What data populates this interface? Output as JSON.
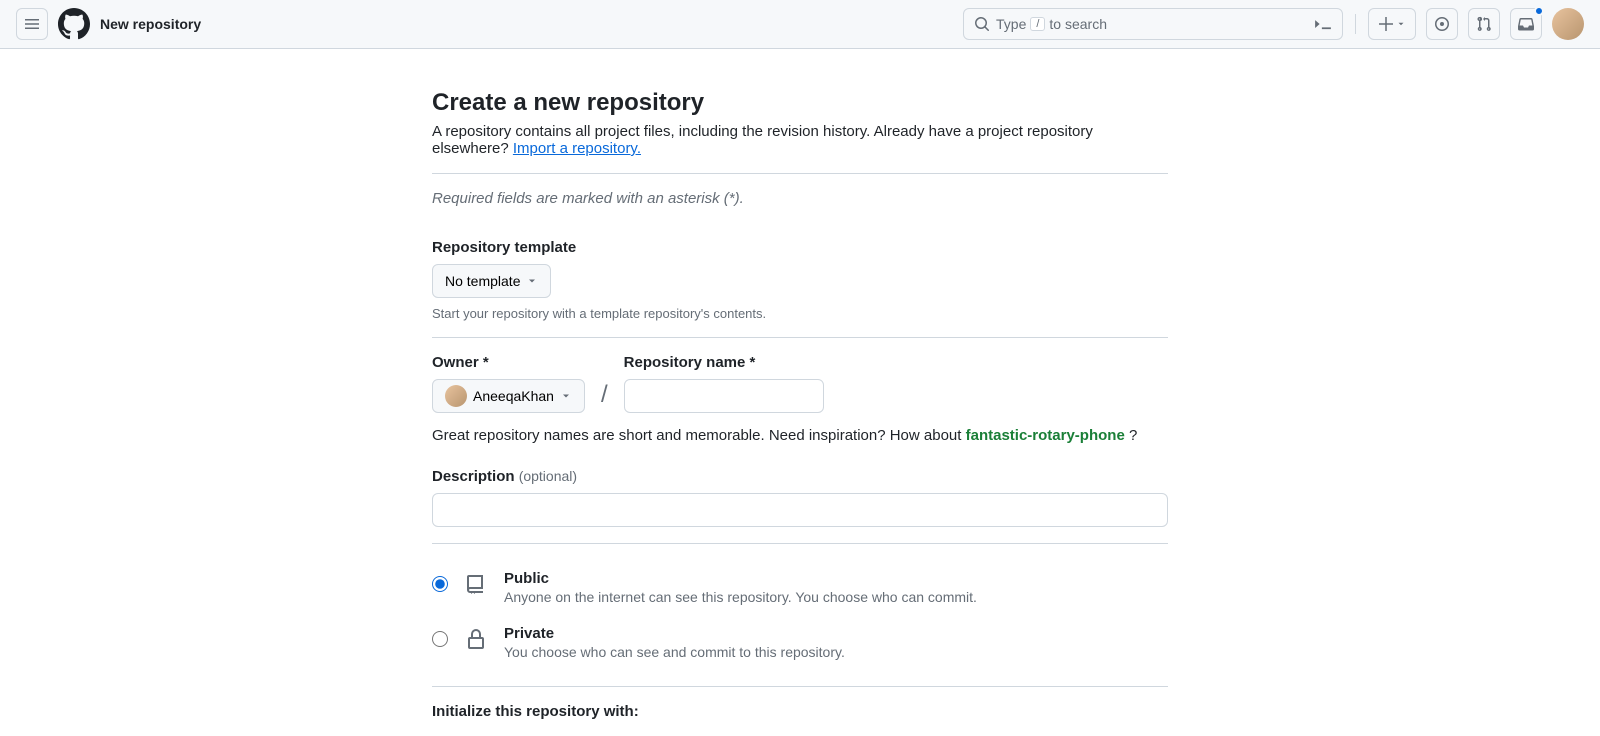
{
  "header": {
    "title": "New repository",
    "search_prefix": "Type",
    "search_key": "/",
    "search_suffix": "to search"
  },
  "page": {
    "heading": "Create a new repository",
    "subtitle_pre": "A repository contains all project files, including the revision history. Already have a project repository elsewhere? ",
    "import_link": "Import a repository.",
    "required_note": "Required fields are marked with an asterisk (*).",
    "template": {
      "label": "Repository template",
      "value": "No template",
      "help": "Start your repository with a template repository's contents."
    },
    "owner": {
      "label": "Owner *",
      "value": "AneeqaKhan"
    },
    "repo_name": {
      "label": "Repository name *"
    },
    "inspire_pre": "Great repository names are short and memorable. Need inspiration? How about ",
    "inspire_suggestion": "fantastic-rotary-phone",
    "inspire_post": " ?",
    "description": {
      "label": "Description",
      "optional": "(optional)"
    },
    "visibility": {
      "public": {
        "title": "Public",
        "desc": "Anyone on the internet can see this repository. You choose who can commit."
      },
      "private": {
        "title": "Private",
        "desc": "You choose who can see and commit to this repository."
      }
    },
    "init_heading": "Initialize this repository with:"
  }
}
